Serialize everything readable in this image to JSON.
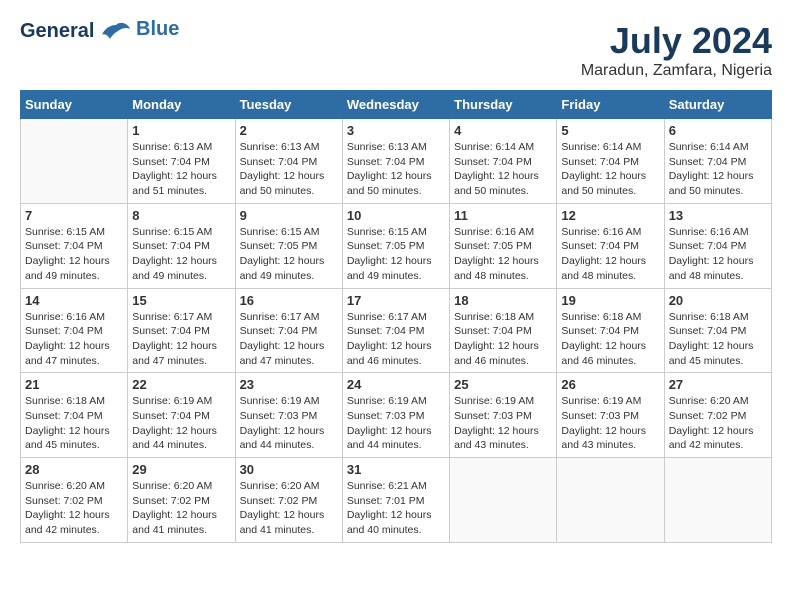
{
  "header": {
    "logo_line1": "General",
    "logo_line2": "Blue",
    "month_year": "July 2024",
    "location": "Maradun, Zamfara, Nigeria"
  },
  "weekdays": [
    "Sunday",
    "Monday",
    "Tuesday",
    "Wednesday",
    "Thursday",
    "Friday",
    "Saturday"
  ],
  "weeks": [
    [
      {
        "day": "",
        "sunrise": "",
        "sunset": "",
        "daylight": ""
      },
      {
        "day": "1",
        "sunrise": "6:13 AM",
        "sunset": "7:04 PM",
        "daylight": "12 hours and 51 minutes."
      },
      {
        "day": "2",
        "sunrise": "6:13 AM",
        "sunset": "7:04 PM",
        "daylight": "12 hours and 50 minutes."
      },
      {
        "day": "3",
        "sunrise": "6:13 AM",
        "sunset": "7:04 PM",
        "daylight": "12 hours and 50 minutes."
      },
      {
        "day": "4",
        "sunrise": "6:14 AM",
        "sunset": "7:04 PM",
        "daylight": "12 hours and 50 minutes."
      },
      {
        "day": "5",
        "sunrise": "6:14 AM",
        "sunset": "7:04 PM",
        "daylight": "12 hours and 50 minutes."
      },
      {
        "day": "6",
        "sunrise": "6:14 AM",
        "sunset": "7:04 PM",
        "daylight": "12 hours and 50 minutes."
      }
    ],
    [
      {
        "day": "7",
        "sunrise": "6:15 AM",
        "sunset": "7:04 PM",
        "daylight": "12 hours and 49 minutes."
      },
      {
        "day": "8",
        "sunrise": "6:15 AM",
        "sunset": "7:04 PM",
        "daylight": "12 hours and 49 minutes."
      },
      {
        "day": "9",
        "sunrise": "6:15 AM",
        "sunset": "7:05 PM",
        "daylight": "12 hours and 49 minutes."
      },
      {
        "day": "10",
        "sunrise": "6:15 AM",
        "sunset": "7:05 PM",
        "daylight": "12 hours and 49 minutes."
      },
      {
        "day": "11",
        "sunrise": "6:16 AM",
        "sunset": "7:05 PM",
        "daylight": "12 hours and 48 minutes."
      },
      {
        "day": "12",
        "sunrise": "6:16 AM",
        "sunset": "7:04 PM",
        "daylight": "12 hours and 48 minutes."
      },
      {
        "day": "13",
        "sunrise": "6:16 AM",
        "sunset": "7:04 PM",
        "daylight": "12 hours and 48 minutes."
      }
    ],
    [
      {
        "day": "14",
        "sunrise": "6:16 AM",
        "sunset": "7:04 PM",
        "daylight": "12 hours and 47 minutes."
      },
      {
        "day": "15",
        "sunrise": "6:17 AM",
        "sunset": "7:04 PM",
        "daylight": "12 hours and 47 minutes."
      },
      {
        "day": "16",
        "sunrise": "6:17 AM",
        "sunset": "7:04 PM",
        "daylight": "12 hours and 47 minutes."
      },
      {
        "day": "17",
        "sunrise": "6:17 AM",
        "sunset": "7:04 PM",
        "daylight": "12 hours and 46 minutes."
      },
      {
        "day": "18",
        "sunrise": "6:18 AM",
        "sunset": "7:04 PM",
        "daylight": "12 hours and 46 minutes."
      },
      {
        "day": "19",
        "sunrise": "6:18 AM",
        "sunset": "7:04 PM",
        "daylight": "12 hours and 46 minutes."
      },
      {
        "day": "20",
        "sunrise": "6:18 AM",
        "sunset": "7:04 PM",
        "daylight": "12 hours and 45 minutes."
      }
    ],
    [
      {
        "day": "21",
        "sunrise": "6:18 AM",
        "sunset": "7:04 PM",
        "daylight": "12 hours and 45 minutes."
      },
      {
        "day": "22",
        "sunrise": "6:19 AM",
        "sunset": "7:04 PM",
        "daylight": "12 hours and 44 minutes."
      },
      {
        "day": "23",
        "sunrise": "6:19 AM",
        "sunset": "7:03 PM",
        "daylight": "12 hours and 44 minutes."
      },
      {
        "day": "24",
        "sunrise": "6:19 AM",
        "sunset": "7:03 PM",
        "daylight": "12 hours and 44 minutes."
      },
      {
        "day": "25",
        "sunrise": "6:19 AM",
        "sunset": "7:03 PM",
        "daylight": "12 hours and 43 minutes."
      },
      {
        "day": "26",
        "sunrise": "6:19 AM",
        "sunset": "7:03 PM",
        "daylight": "12 hours and 43 minutes."
      },
      {
        "day": "27",
        "sunrise": "6:20 AM",
        "sunset": "7:02 PM",
        "daylight": "12 hours and 42 minutes."
      }
    ],
    [
      {
        "day": "28",
        "sunrise": "6:20 AM",
        "sunset": "7:02 PM",
        "daylight": "12 hours and 42 minutes."
      },
      {
        "day": "29",
        "sunrise": "6:20 AM",
        "sunset": "7:02 PM",
        "daylight": "12 hours and 41 minutes."
      },
      {
        "day": "30",
        "sunrise": "6:20 AM",
        "sunset": "7:02 PM",
        "daylight": "12 hours and 41 minutes."
      },
      {
        "day": "31",
        "sunrise": "6:21 AM",
        "sunset": "7:01 PM",
        "daylight": "12 hours and 40 minutes."
      },
      {
        "day": "",
        "sunrise": "",
        "sunset": "",
        "daylight": ""
      },
      {
        "day": "",
        "sunrise": "",
        "sunset": "",
        "daylight": ""
      },
      {
        "day": "",
        "sunrise": "",
        "sunset": "",
        "daylight": ""
      }
    ]
  ],
  "labels": {
    "sunrise": "Sunrise:",
    "sunset": "Sunset:",
    "daylight": "Daylight:"
  }
}
